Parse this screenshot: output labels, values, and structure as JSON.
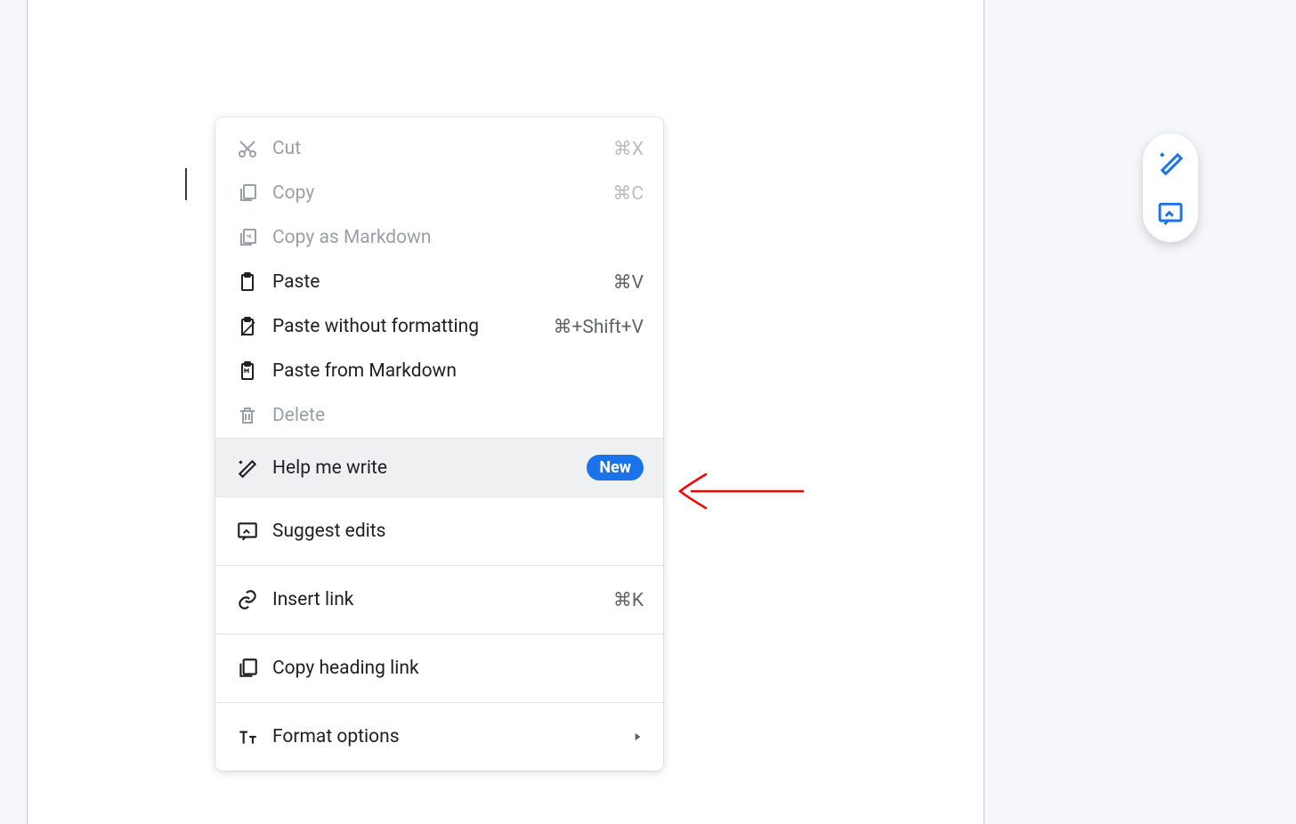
{
  "menu": {
    "cut": {
      "label": "Cut",
      "shortcut": "⌘X"
    },
    "copy": {
      "label": "Copy",
      "shortcut": "⌘C"
    },
    "copy_md": {
      "label": "Copy as Markdown"
    },
    "paste": {
      "label": "Paste",
      "shortcut": "⌘V"
    },
    "paste_plain": {
      "label": "Paste without formatting",
      "shortcut": "⌘+Shift+V"
    },
    "paste_md": {
      "label": "Paste from Markdown"
    },
    "delete": {
      "label": "Delete"
    },
    "help_write": {
      "label": "Help me write",
      "badge": "New"
    },
    "suggest_edits": {
      "label": "Suggest edits"
    },
    "insert_link": {
      "label": "Insert link",
      "shortcut": "⌘K"
    },
    "copy_heading_link": {
      "label": "Copy heading link"
    },
    "format_options": {
      "label": "Format options"
    }
  },
  "colors": {
    "accent": "#1a73e8",
    "annotation": "#ff0000"
  }
}
